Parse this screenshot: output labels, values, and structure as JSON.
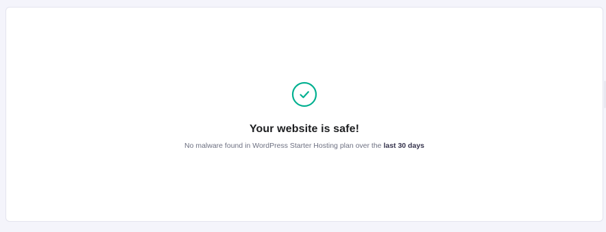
{
  "status": {
    "icon": "check-circle-icon",
    "title": "Your website is safe!",
    "message_prefix": "No malware found in WordPress Starter Hosting plan over the ",
    "message_emphasis": "last 30 days"
  },
  "colors": {
    "success": "#00b090",
    "title": "#1d1e20",
    "text": "#6d7081",
    "background": "#f4f4fb",
    "card": "#ffffff"
  }
}
